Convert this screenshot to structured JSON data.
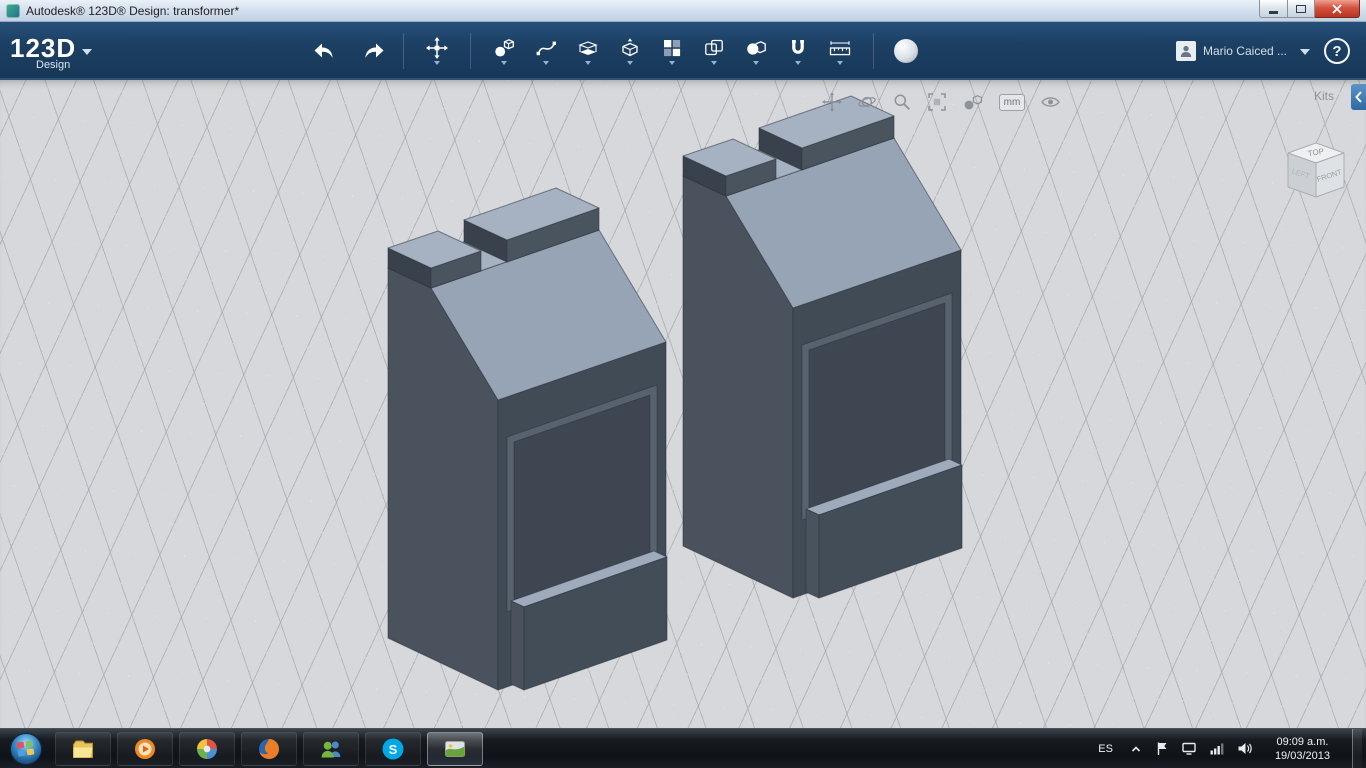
{
  "window": {
    "title": "Autodesk® 123D® Design: transformer*"
  },
  "header": {
    "logo_main": "123D",
    "logo_sub": "Design",
    "user_name": "Mario Caiced ...",
    "help_glyph": "?"
  },
  "viewport": {
    "kits_label": "Kits",
    "units_badge": "mm",
    "view_cube": {
      "top": "TOP",
      "front": "FRONT",
      "left": "LEFT"
    }
  },
  "taskbar": {
    "language": "ES",
    "skype_letter": "S",
    "clock_time": "09:09 a.m.",
    "clock_date": "19/03/2013"
  },
  "colors": {
    "header_bg": "#1c3f63",
    "viewport_bg": "#d6d8db",
    "model_front": "#49525d",
    "model_side": "#414b56",
    "model_top": "#9daaba",
    "close_button_red": "#c0392a",
    "kits_tab_blue": "#3b77b0",
    "taskbar_bg": "#14181d"
  }
}
